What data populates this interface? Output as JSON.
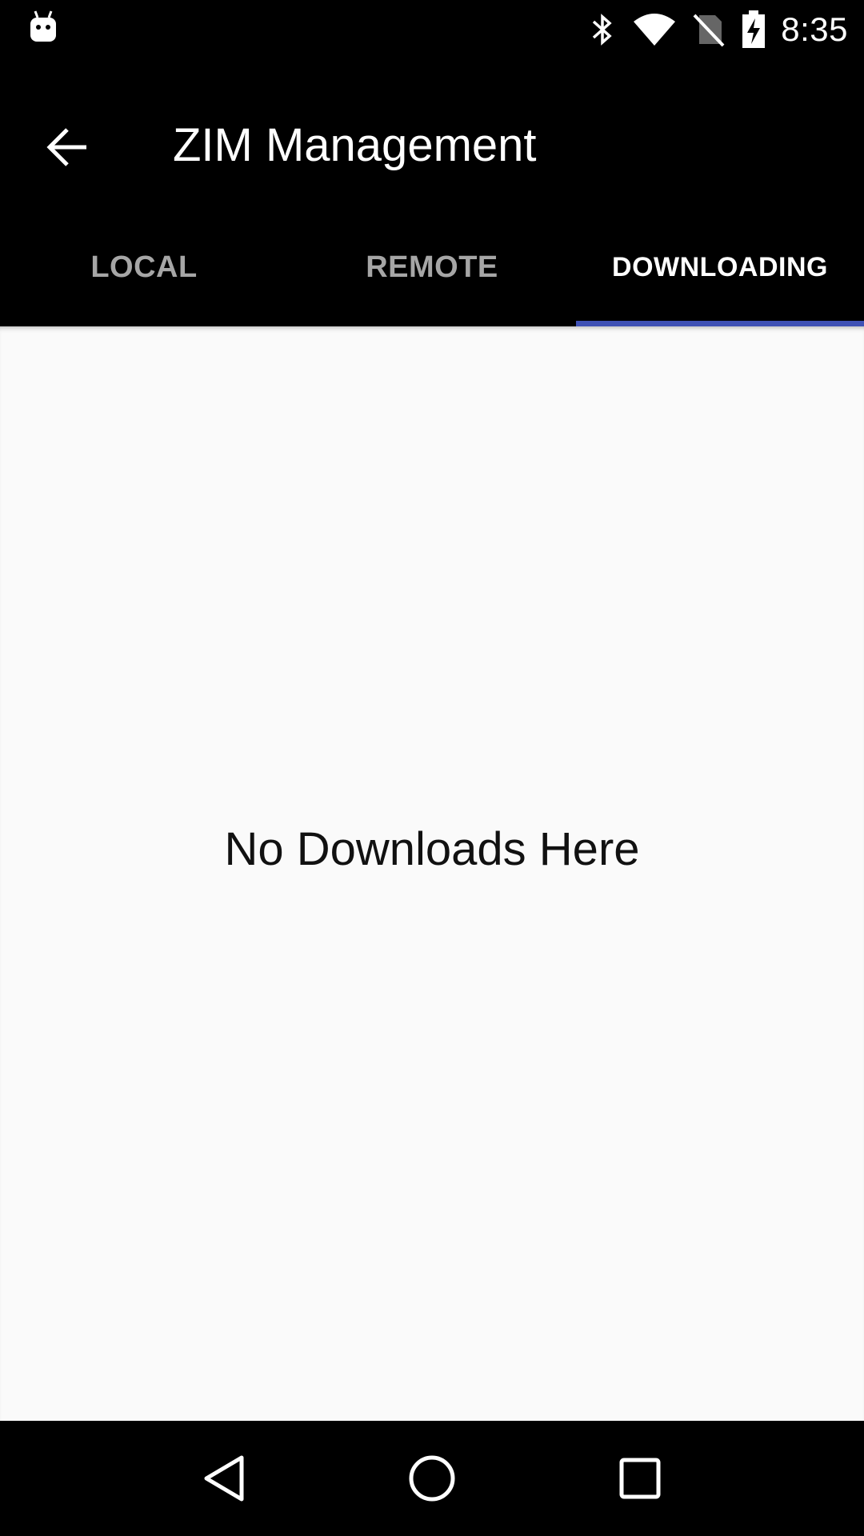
{
  "status_bar": {
    "time": "8:35",
    "icons": [
      "android-notification-icon",
      "bluetooth-icon",
      "wifi-icon",
      "no-sim-icon",
      "battery-charging-icon"
    ]
  },
  "app_bar": {
    "title": "ZIM Management",
    "back_icon": "arrow-back-icon"
  },
  "tabs": [
    {
      "label": "LOCAL",
      "active": false
    },
    {
      "label": "REMOTE",
      "active": false
    },
    {
      "label": "DOWNLOADING",
      "active": true
    }
  ],
  "content": {
    "empty_message": "No Downloads Here"
  },
  "nav_bar": {
    "icons": [
      "back-triangle-icon",
      "home-circle-icon",
      "recents-square-icon"
    ]
  },
  "colors": {
    "app_bar_bg": "#000000",
    "tab_indicator": "#3f51b5",
    "content_bg": "#fafafa",
    "inactive_tab_text": "#a6a6a6"
  }
}
